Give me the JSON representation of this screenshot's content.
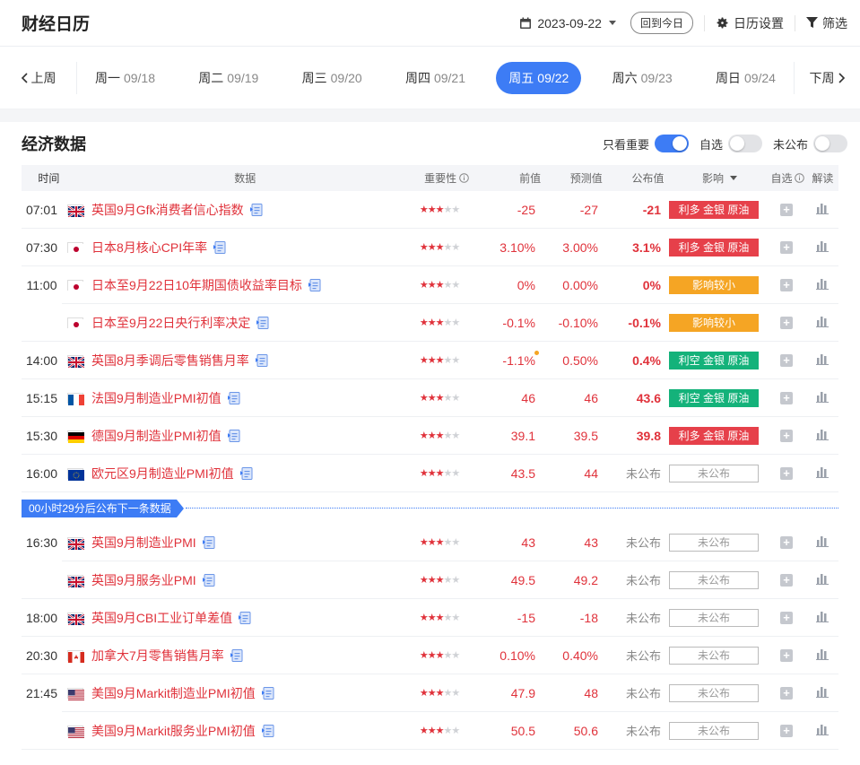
{
  "header": {
    "title": "财经日历",
    "date": "2023-09-22",
    "today_label": "回到今日",
    "settings_label": "日历设置",
    "filter_label": "筛选"
  },
  "week": {
    "prev_label": "上周",
    "next_label": "下周",
    "days": [
      {
        "name": "周一",
        "date": "09/18",
        "active": false
      },
      {
        "name": "周二",
        "date": "09/19",
        "active": false
      },
      {
        "name": "周三",
        "date": "09/20",
        "active": false
      },
      {
        "name": "周四",
        "date": "09/21",
        "active": false
      },
      {
        "name": "周五",
        "date": "09/22",
        "active": true
      },
      {
        "name": "周六",
        "date": "09/23",
        "active": false
      },
      {
        "name": "周日",
        "date": "09/24",
        "active": false
      }
    ]
  },
  "section": {
    "title": "经济数据",
    "toggles": [
      {
        "label": "只看重要",
        "on": true
      },
      {
        "label": "自选",
        "on": false
      },
      {
        "label": "未公布",
        "on": false
      }
    ]
  },
  "table": {
    "columns": {
      "time": "时间",
      "data": "数据",
      "importance": "重要性",
      "previous": "前值",
      "forecast": "预测值",
      "actual": "公布值",
      "impact": "影响",
      "favorite": "自选",
      "interpret": "解读"
    },
    "rows_before": [
      {
        "time": "07:01",
        "flag": "uk",
        "name": "英国9月Gfk消费者信心指数",
        "stars": 3,
        "prev": "-25",
        "fc": "-27",
        "act": "-21",
        "impact": "利多 金银 原油",
        "impact_type": "red",
        "first": true
      },
      {
        "time": "07:30",
        "flag": "jp",
        "name": "日本8月核心CPI年率",
        "stars": 3,
        "prev": "3.10%",
        "fc": "3.00%",
        "act": "3.1%",
        "impact": "利多 金银 原油",
        "impact_type": "red",
        "first": true
      },
      {
        "time": "11:00",
        "flag": "jp",
        "name": "日本至9月22日10年期国债收益率目标",
        "stars": 3,
        "prev": "0%",
        "fc": "0.00%",
        "act": "0%",
        "impact": "影响较小",
        "impact_type": "orange",
        "first": false
      },
      {
        "time": "",
        "flag": "jp",
        "name": "日本至9月22日央行利率决定",
        "stars": 3,
        "prev": "-0.1%",
        "fc": "-0.10%",
        "act": "-0.1%",
        "impact": "影响较小",
        "impact_type": "orange",
        "first": true
      },
      {
        "time": "14:00",
        "flag": "uk",
        "name": "英国8月季调后零售销售月率",
        "stars": 3,
        "prev": "-1.1%",
        "fc": "0.50%",
        "act": "0.4%",
        "impact": "利空 金银 原油",
        "impact_type": "green",
        "first": true,
        "dot": true
      },
      {
        "time": "15:15",
        "flag": "fr",
        "name": "法国9月制造业PMI初值",
        "stars": 3,
        "prev": "46",
        "fc": "46",
        "act": "43.6",
        "impact": "利空 金银 原油",
        "impact_type": "green",
        "first": true
      },
      {
        "time": "15:30",
        "flag": "de",
        "name": "德国9月制造业PMI初值",
        "stars": 3,
        "prev": "39.1",
        "fc": "39.5",
        "act": "39.8",
        "impact": "利多 金银 原油",
        "impact_type": "red",
        "first": true
      },
      {
        "time": "16:00",
        "flag": "eu",
        "name": "欧元区9月制造业PMI初值",
        "stars": 3,
        "prev": "43.5",
        "fc": "44",
        "act": "未公布",
        "impact": "未公布",
        "impact_type": "none",
        "first": true
      }
    ],
    "notice": "00小时29分后公布下一条数据",
    "rows_after": [
      {
        "time": "16:30",
        "flag": "uk",
        "name": "英国9月制造业PMI",
        "stars": 3,
        "prev": "43",
        "fc": "43",
        "act": "未公布",
        "impact": "未公布",
        "impact_type": "none",
        "first": false
      },
      {
        "time": "",
        "flag": "uk",
        "name": "英国9月服务业PMI",
        "stars": 3,
        "prev": "49.5",
        "fc": "49.2",
        "act": "未公布",
        "impact": "未公布",
        "impact_type": "none",
        "first": true
      },
      {
        "time": "18:00",
        "flag": "uk",
        "name": "英国9月CBI工业订单差值",
        "stars": 3,
        "prev": "-15",
        "fc": "-18",
        "act": "未公布",
        "impact": "未公布",
        "impact_type": "none",
        "first": true
      },
      {
        "time": "20:30",
        "flag": "ca",
        "name": "加拿大7月零售销售月率",
        "stars": 3,
        "prev": "0.10%",
        "fc": "0.40%",
        "act": "未公布",
        "impact": "未公布",
        "impact_type": "none",
        "first": true
      },
      {
        "time": "21:45",
        "flag": "us",
        "name": "美国9月Markit制造业PMI初值",
        "stars": 3,
        "prev": "47.9",
        "fc": "48",
        "act": "未公布",
        "impact": "未公布",
        "impact_type": "none",
        "first": false
      },
      {
        "time": "",
        "flag": "us",
        "name": "美国9月Markit服务业PMI初值",
        "stars": 3,
        "prev": "50.5",
        "fc": "50.6",
        "act": "未公布",
        "impact": "未公布",
        "impact_type": "none",
        "first": true
      }
    ]
  }
}
